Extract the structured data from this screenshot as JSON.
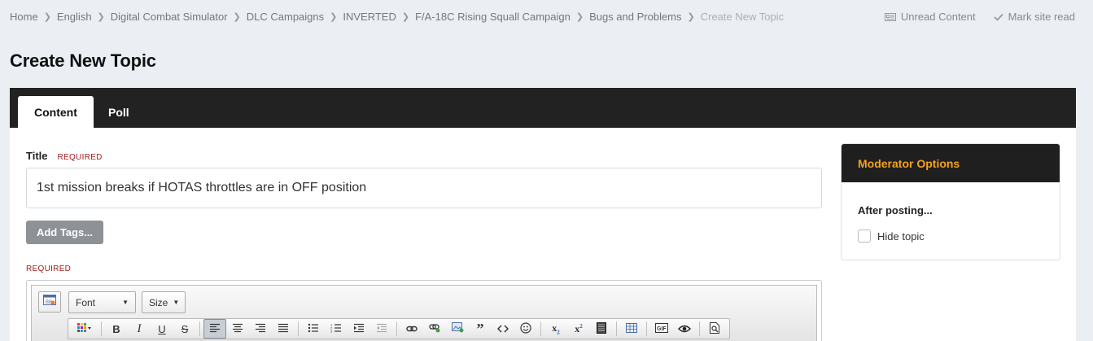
{
  "breadcrumb": {
    "items": [
      "Home",
      "English",
      "Digital Combat Simulator",
      "DLC Campaigns",
      "INVERTED",
      "F/A-18C Rising Squall Campaign",
      "Bugs and Problems"
    ],
    "current": "Create New Topic"
  },
  "top_actions": {
    "unread": "Unread Content",
    "mark_read": "Mark site read"
  },
  "page_title": "Create New Topic",
  "tabs": [
    {
      "label": "Content",
      "active": true
    },
    {
      "label": "Poll",
      "active": false
    }
  ],
  "form": {
    "title_label": "Title",
    "required": "REQUIRED",
    "title_value": "1st mission breaks if HOTAS throttles are in OFF position",
    "add_tags": "Add Tags...",
    "required_2": "REQUIRED"
  },
  "editor": {
    "font_combo": "Font",
    "size_combo": "Size",
    "active_button": "align-left"
  },
  "moderator": {
    "title": "Moderator Options",
    "after_posting": "After posting...",
    "hide_topic": "Hide topic"
  },
  "colors": {
    "accent": "#f4a21e",
    "tabbar": "#222222",
    "required": "#a02020"
  }
}
